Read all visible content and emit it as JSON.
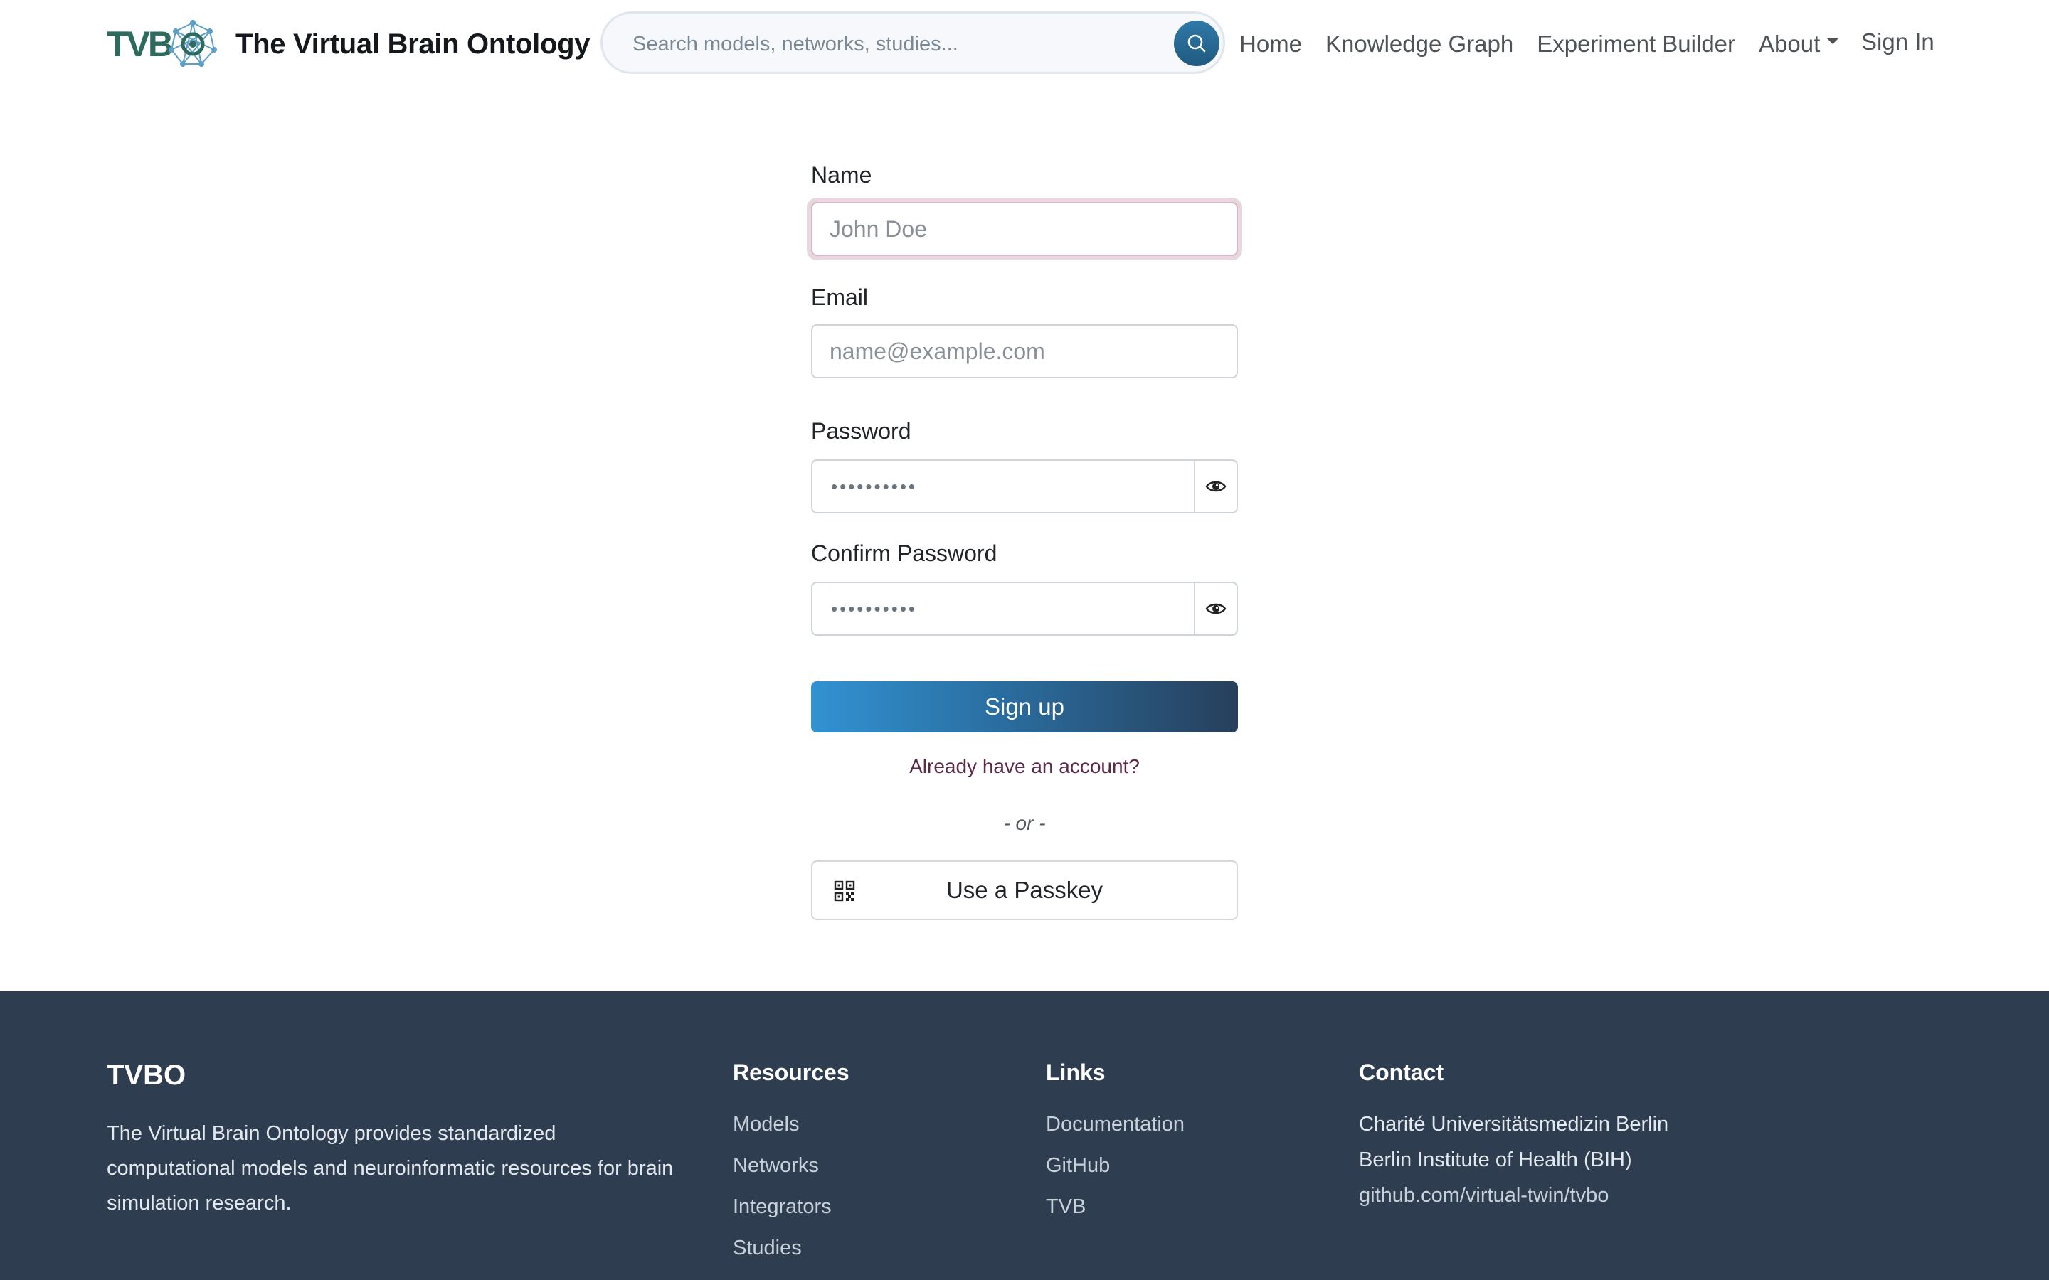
{
  "header": {
    "logo_text": "TVB",
    "title": "The Virtual Brain Ontology",
    "search": {
      "placeholder": "Search models, networks, studies...",
      "value": ""
    },
    "nav": [
      {
        "label": "Home"
      },
      {
        "label": "Knowledge Graph"
      },
      {
        "label": "Experiment Builder"
      },
      {
        "label": "About"
      }
    ],
    "signin_label": "Sign In"
  },
  "form": {
    "name": {
      "label": "Name",
      "placeholder": "John Doe",
      "value": ""
    },
    "email": {
      "label": "Email",
      "placeholder": "name@example.com",
      "value": ""
    },
    "password": {
      "label": "Password",
      "masked_value": "••••••••••"
    },
    "confirm_password": {
      "label": "Confirm Password",
      "masked_value": "••••••••••"
    },
    "signup_label": "Sign up",
    "already_label": "Already have an account?",
    "or_label": "- or -",
    "passkey_label": "Use a Passkey"
  },
  "footer": {
    "brand": "TVBO",
    "description": "The Virtual Brain Ontology provides standardized computational models and neuroinformatic resources for brain simulation research.",
    "resources": {
      "heading": "Resources",
      "items": [
        "Models",
        "Networks",
        "Integrators",
        "Studies"
      ]
    },
    "links": {
      "heading": "Links",
      "items": [
        "Documentation",
        "GitHub",
        "TVB"
      ]
    },
    "contact": {
      "heading": "Contact",
      "items": [
        "Charité Universitätsmedizin Berlin",
        "Berlin Institute of Health (BIH)",
        "github.com/virtual-twin/tvbo"
      ]
    }
  },
  "colors": {
    "accent": "#3292d2",
    "footer_bg": "#2e3e50",
    "link": "#5b2a48",
    "logo": "#2d6b5f"
  },
  "icons": [
    "tvbo-network-logo-icon",
    "search-icon",
    "eye-icon",
    "qr-passkey-icon"
  ]
}
